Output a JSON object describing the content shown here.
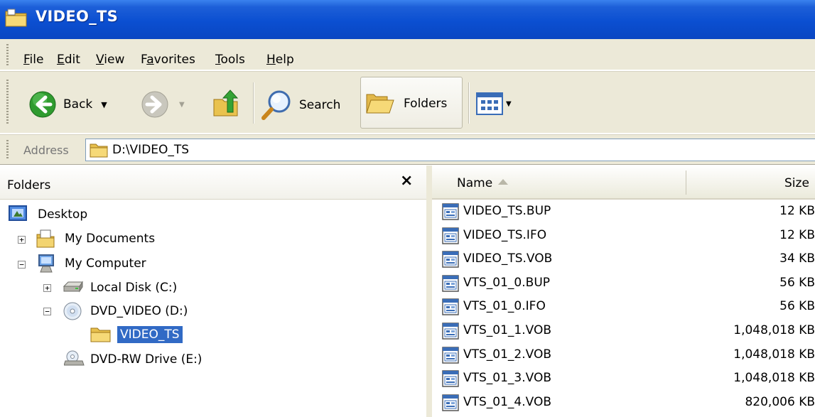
{
  "window": {
    "title": "VIDEO_TS"
  },
  "menu": {
    "items": [
      {
        "label": "File",
        "key": "F",
        "rest": "ile"
      },
      {
        "label": "Edit",
        "key": "E",
        "rest": "dit"
      },
      {
        "label": "View",
        "key": "V",
        "rest": "iew"
      },
      {
        "label": "Favorites",
        "pre": "F",
        "key": "a",
        "rest": "vorites"
      },
      {
        "label": "Tools",
        "key": "T",
        "rest": "ools"
      },
      {
        "label": "Help",
        "key": "H",
        "rest": "elp"
      }
    ]
  },
  "toolbar": {
    "back_label": "Back",
    "search_label": "Search",
    "folders_label": "Folders"
  },
  "address": {
    "label": "Address",
    "value": "D:\\VIDEO_TS"
  },
  "folders_pane": {
    "title": "Folders",
    "close_glyph": "×",
    "tree": [
      {
        "label": "Desktop",
        "level": 0,
        "toggle": "",
        "icon": "desktop-icon"
      },
      {
        "label": "My Documents",
        "level": 1,
        "toggle": "+",
        "icon": "my-documents-icon"
      },
      {
        "label": "My Computer",
        "level": 1,
        "toggle": "−",
        "icon": "my-computer-icon"
      },
      {
        "label": "Local Disk (C:)",
        "level": 2,
        "toggle": "+",
        "icon": "hard-disk-icon"
      },
      {
        "label": "DVD_VIDEO (D:)",
        "level": 2,
        "toggle": "−",
        "icon": "dvd-disc-icon"
      },
      {
        "label": "VIDEO_TS",
        "level": 3,
        "toggle": "",
        "icon": "folder-icon",
        "selected": true
      },
      {
        "label": "DVD-RW Drive (E:)",
        "level": 2,
        "toggle": "",
        "icon": "dvd-rw-drive-icon"
      }
    ]
  },
  "details": {
    "columns": {
      "name": "Name",
      "size": "Size"
    },
    "files": [
      {
        "name": "VIDEO_TS.BUP",
        "size": "12 KB"
      },
      {
        "name": "VIDEO_TS.IFO",
        "size": "12 KB"
      },
      {
        "name": "VIDEO_TS.VOB",
        "size": "34 KB"
      },
      {
        "name": "VTS_01_0.BUP",
        "size": "56 KB"
      },
      {
        "name": "VTS_01_0.IFO",
        "size": "56 KB"
      },
      {
        "name": "VTS_01_1.VOB",
        "size": "1,048,018 KB"
      },
      {
        "name": "VTS_01_2.VOB",
        "size": "1,048,018 KB"
      },
      {
        "name": "VTS_01_3.VOB",
        "size": "1,048,018 KB"
      },
      {
        "name": "VTS_01_4.VOB",
        "size": "820,006 KB"
      }
    ]
  },
  "colors": {
    "title_blue": "#0b4fd1",
    "bar_beige": "#ece9d8",
    "selection_blue": "#316ac5"
  }
}
